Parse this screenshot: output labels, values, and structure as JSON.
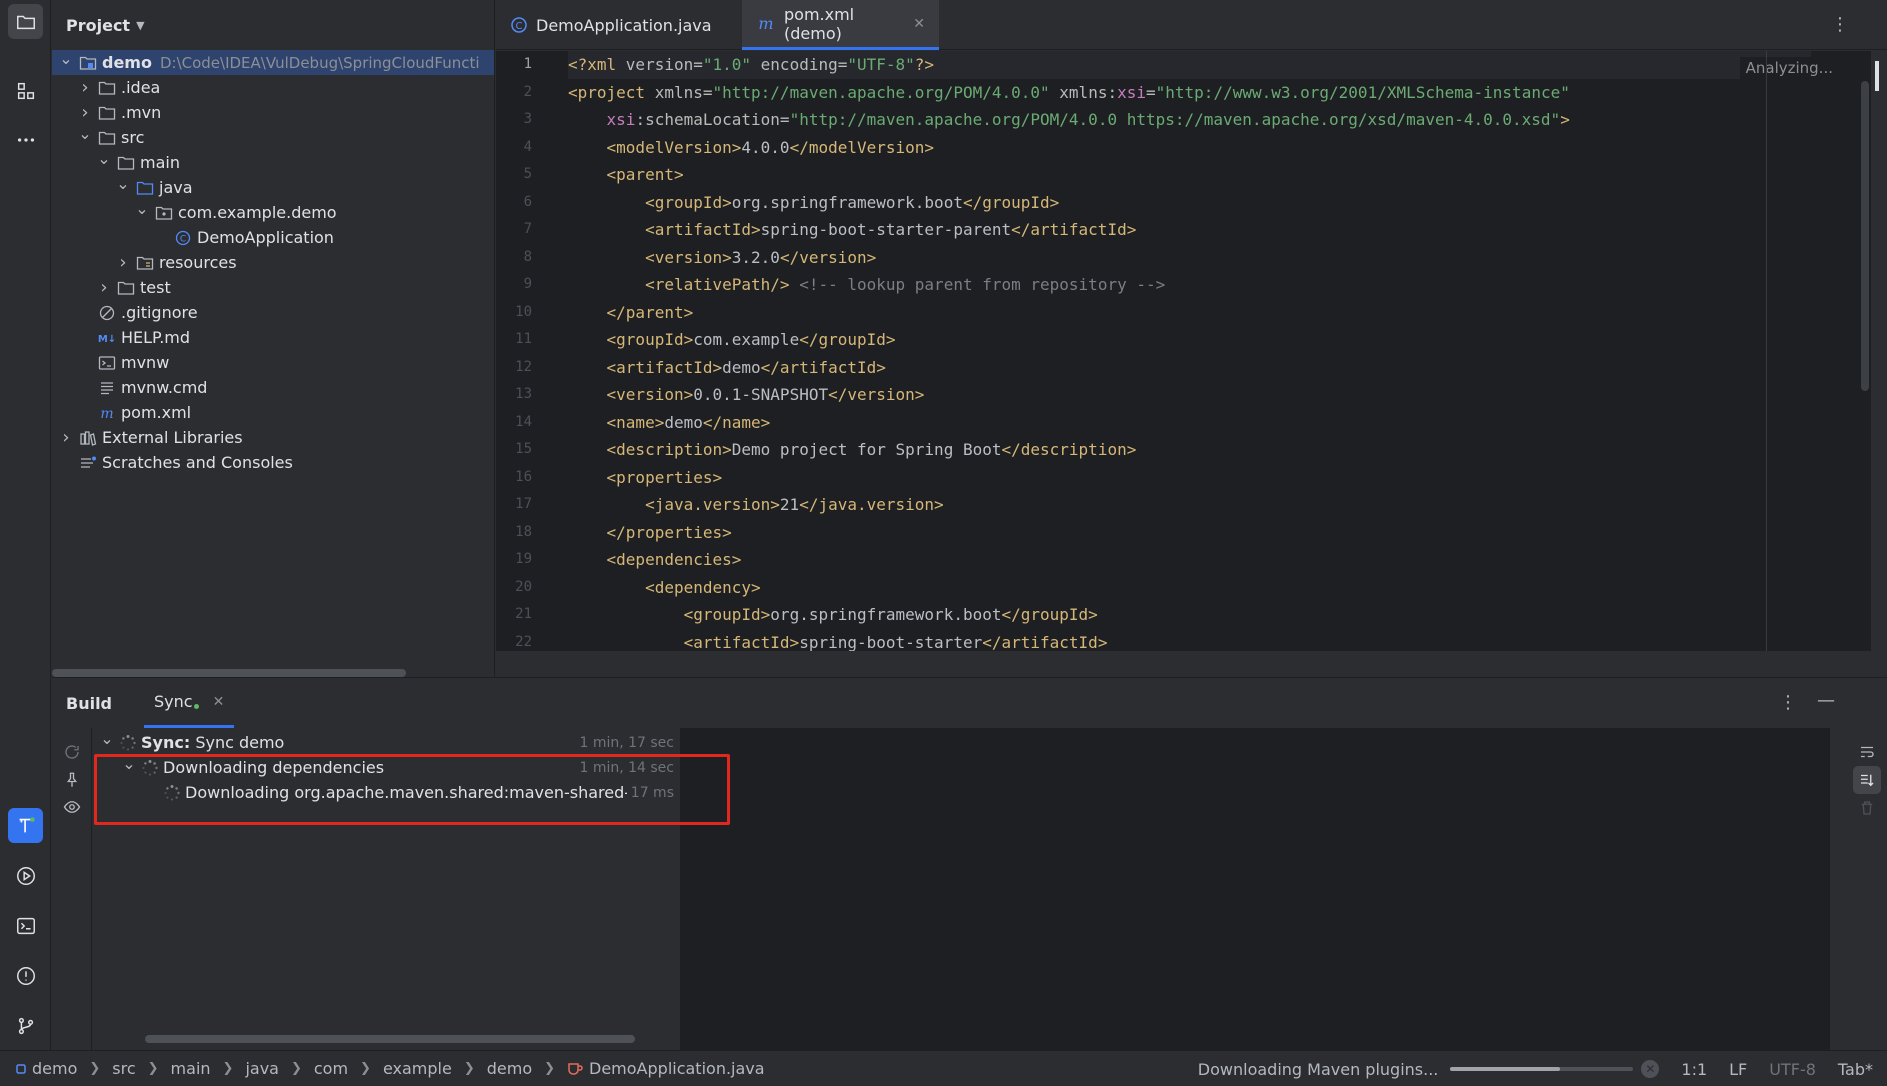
{
  "project_panel": {
    "title": "Project",
    "tree": [
      {
        "label": "demo",
        "path": "D:\\Code\\IDEA\\VulDebug\\SpringCloudFuncti",
        "depth": 0,
        "arrow": "down",
        "icon": "module-folder",
        "selected": true,
        "bold": true
      },
      {
        "label": ".idea",
        "depth": 1,
        "arrow": "right",
        "icon": "folder"
      },
      {
        "label": ".mvn",
        "depth": 1,
        "arrow": "right",
        "icon": "folder"
      },
      {
        "label": "src",
        "depth": 1,
        "arrow": "down",
        "icon": "folder"
      },
      {
        "label": "main",
        "depth": 2,
        "arrow": "down",
        "icon": "folder"
      },
      {
        "label": "java",
        "depth": 3,
        "arrow": "down",
        "icon": "source-folder"
      },
      {
        "label": "com.example.demo",
        "depth": 4,
        "arrow": "down",
        "icon": "package"
      },
      {
        "label": "DemoApplication",
        "depth": 5,
        "arrow": "",
        "icon": "class"
      },
      {
        "label": "resources",
        "depth": 3,
        "arrow": "right",
        "icon": "resources-folder"
      },
      {
        "label": "test",
        "depth": 2,
        "arrow": "right",
        "icon": "folder"
      },
      {
        "label": ".gitignore",
        "depth": 1,
        "arrow": "",
        "icon": "ignore"
      },
      {
        "label": "HELP.md",
        "depth": 1,
        "arrow": "",
        "icon": "markdown"
      },
      {
        "label": "mvnw",
        "depth": 1,
        "arrow": "",
        "icon": "shell"
      },
      {
        "label": "mvnw.cmd",
        "depth": 1,
        "arrow": "",
        "icon": "text"
      },
      {
        "label": "pom.xml",
        "depth": 1,
        "arrow": "",
        "icon": "maven"
      },
      {
        "label": "External Libraries",
        "depth": 0,
        "arrow": "right",
        "icon": "library"
      },
      {
        "label": "Scratches and Consoles",
        "depth": 0,
        "arrow": "",
        "icon": "scratches"
      }
    ]
  },
  "editor": {
    "tabs": [
      {
        "label": "DemoApplication.java",
        "active": false
      },
      {
        "label": "pom.xml (demo)",
        "active": true
      }
    ],
    "analyzing": "Analyzing...",
    "line_numbers": [
      "1",
      "2",
      "3",
      "4",
      "5",
      "6",
      "7",
      "8",
      "9",
      "10",
      "11",
      "12",
      "13",
      "14",
      "15",
      "16",
      "17",
      "18",
      "19",
      "20",
      "21",
      "22"
    ],
    "lines": [
      [
        [
          "tg",
          "<?xml "
        ],
        [
          "at",
          "version="
        ],
        [
          "av",
          "\"1.0\""
        ],
        [
          "at",
          " encoding="
        ],
        [
          "av",
          "\"UTF-8\""
        ],
        [
          "tg",
          "?>"
        ]
      ],
      [
        [
          "tg",
          "<project "
        ],
        [
          "at",
          "xmlns="
        ],
        [
          "av",
          "\"http://maven.apache.org/POM/4.0.0\""
        ],
        [
          "at",
          " xmlns:"
        ],
        [
          "ns",
          "xsi"
        ],
        [
          "at",
          "="
        ],
        [
          "av",
          "\"http://www.w3.org/2001/XMLSchema-instance\""
        ]
      ],
      [
        [
          "tx",
          "    "
        ],
        [
          "ns",
          "xsi"
        ],
        [
          "at",
          ":schemaLocation="
        ],
        [
          "av",
          "\"http://maven.apache.org/POM/4.0.0 https://maven.apache.org/xsd/maven-4.0.0.xsd\""
        ],
        [
          "tg",
          ">"
        ]
      ],
      [
        [
          "tx",
          "    "
        ],
        [
          "tg",
          "<modelVersion>"
        ],
        [
          "tx",
          "4.0.0"
        ],
        [
          "tg",
          "</modelVersion>"
        ]
      ],
      [
        [
          "tx",
          "    "
        ],
        [
          "tg",
          "<parent>"
        ]
      ],
      [
        [
          "tx",
          "        "
        ],
        [
          "tg",
          "<groupId>"
        ],
        [
          "tx",
          "org.springframework.boot"
        ],
        [
          "tg",
          "</groupId>"
        ]
      ],
      [
        [
          "tx",
          "        "
        ],
        [
          "tg",
          "<artifactId>"
        ],
        [
          "tx",
          "spring-boot-starter-parent"
        ],
        [
          "tg",
          "</artifactId>"
        ]
      ],
      [
        [
          "tx",
          "        "
        ],
        [
          "tg",
          "<version>"
        ],
        [
          "tx",
          "3.2.0"
        ],
        [
          "tg",
          "</version>"
        ]
      ],
      [
        [
          "tx",
          "        "
        ],
        [
          "tg",
          "<relativePath/>"
        ],
        [
          "cm",
          " <!-- lookup parent from repository -->"
        ]
      ],
      [
        [
          "tx",
          "    "
        ],
        [
          "tg",
          "</parent>"
        ]
      ],
      [
        [
          "tx",
          "    "
        ],
        [
          "tg",
          "<groupId>"
        ],
        [
          "tx",
          "com.example"
        ],
        [
          "tg",
          "</groupId>"
        ]
      ],
      [
        [
          "tx",
          "    "
        ],
        [
          "tg",
          "<artifactId>"
        ],
        [
          "tx",
          "demo"
        ],
        [
          "tg",
          "</artifactId>"
        ]
      ],
      [
        [
          "tx",
          "    "
        ],
        [
          "tg",
          "<version>"
        ],
        [
          "tx",
          "0.0.1-SNAPSHOT"
        ],
        [
          "tg",
          "</version>"
        ]
      ],
      [
        [
          "tx",
          "    "
        ],
        [
          "tg",
          "<name>"
        ],
        [
          "tx",
          "demo"
        ],
        [
          "tg",
          "</name>"
        ]
      ],
      [
        [
          "tx",
          "    "
        ],
        [
          "tg",
          "<description>"
        ],
        [
          "tx",
          "Demo project for Spring Boot"
        ],
        [
          "tg",
          "</description>"
        ]
      ],
      [
        [
          "tx",
          "    "
        ],
        [
          "tg",
          "<properties>"
        ]
      ],
      [
        [
          "tx",
          "        "
        ],
        [
          "tg",
          "<java.version>"
        ],
        [
          "tx",
          "21"
        ],
        [
          "tg",
          "</java.version>"
        ]
      ],
      [
        [
          "tx",
          "    "
        ],
        [
          "tg",
          "</properties>"
        ]
      ],
      [
        [
          "tx",
          "    "
        ],
        [
          "tg",
          "<dependencies>"
        ]
      ],
      [
        [
          "tx",
          "        "
        ],
        [
          "tg",
          "<dependency>"
        ]
      ],
      [
        [
          "tx",
          "            "
        ],
        [
          "tg",
          "<groupId>"
        ],
        [
          "tx",
          "org.springframework.boot"
        ],
        [
          "tg",
          "</groupId>"
        ]
      ],
      [
        [
          "tx",
          "            "
        ],
        [
          "tg",
          "<artifactId>"
        ],
        [
          "tx",
          "spring-boot-starter"
        ],
        [
          "tg",
          "</artifactId>"
        ]
      ]
    ]
  },
  "build_panel": {
    "title": "Build",
    "tab": "Sync",
    "rows": [
      {
        "bold_prefix": "Sync:",
        "label": " Sync demo",
        "time": "1 min, 17 sec",
        "depth": 0,
        "arrow": "down"
      },
      {
        "bold_prefix": "",
        "label": "Downloading dependencies",
        "time": "1 min, 14 sec",
        "depth": 1,
        "arrow": "down"
      },
      {
        "bold_prefix": "",
        "label": "Downloading org.apache.maven.shared:maven-shared-c",
        "time": "17 ms",
        "depth": 2,
        "arrow": ""
      }
    ]
  },
  "status_bar": {
    "breadcrumbs": [
      "demo",
      "src",
      "main",
      "java",
      "com",
      "example",
      "demo",
      "DemoApplication.java"
    ],
    "progress_label": "Downloading Maven plugins...",
    "progress_fraction": 0.6,
    "position": "1:1",
    "line_ending": "LF",
    "encoding": "UTF-8",
    "indent": "Tab*"
  },
  "colors": {
    "accent": "#3574f0",
    "highlight_box": "#e0281f",
    "selection": "#2e436e"
  }
}
